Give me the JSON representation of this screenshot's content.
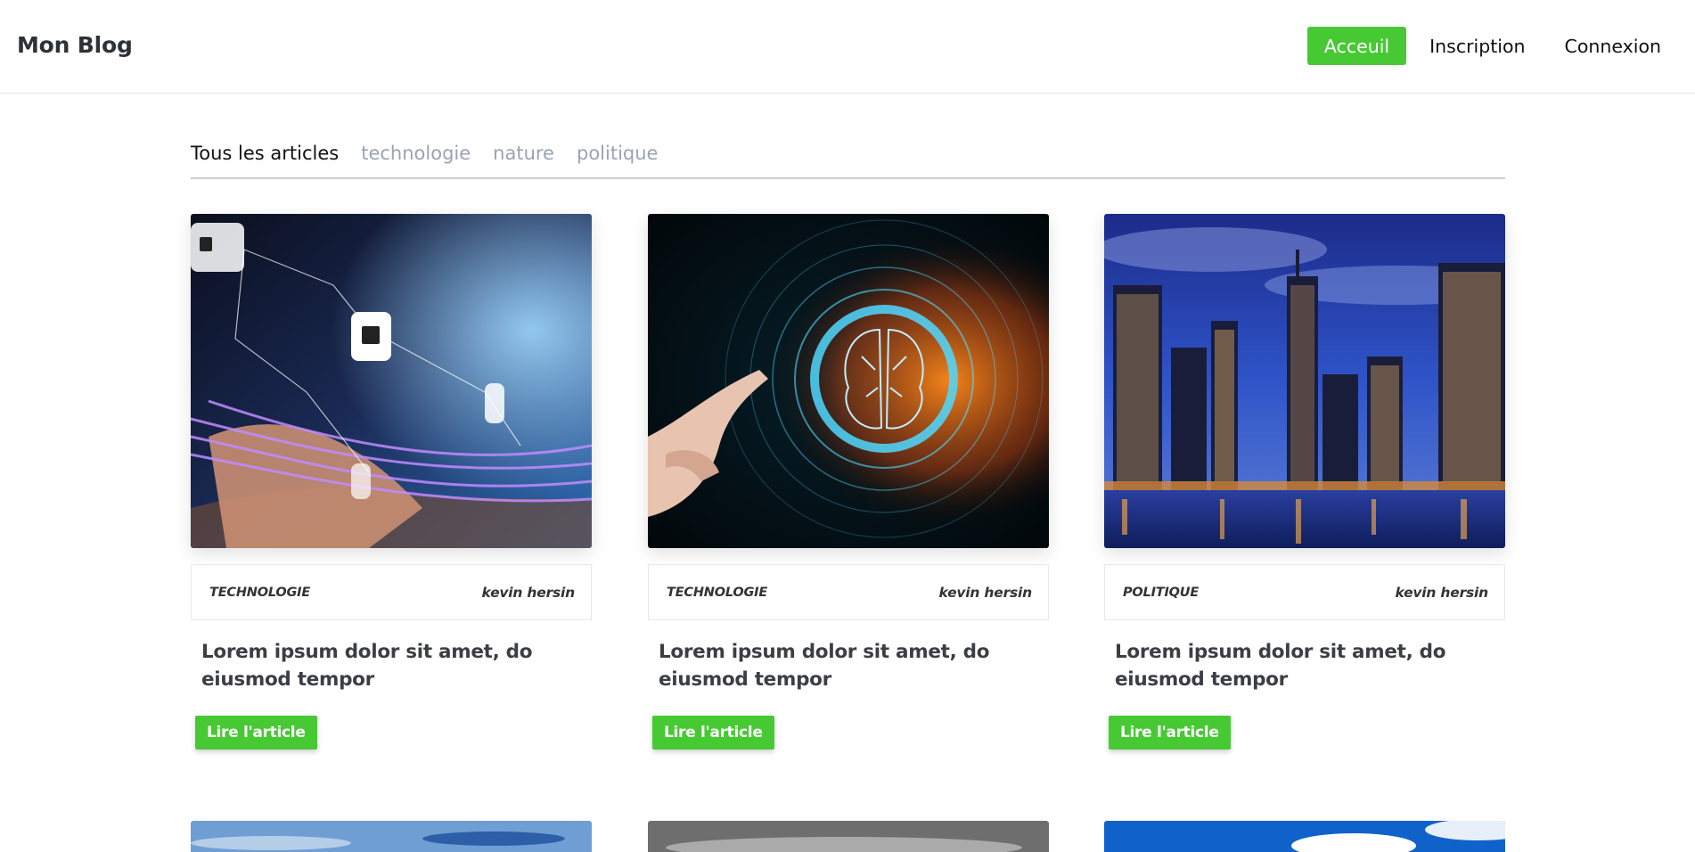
{
  "header": {
    "brand": "Mon Blog",
    "nav": [
      {
        "label": "Acceuil",
        "active": true
      },
      {
        "label": "Inscription",
        "active": false
      },
      {
        "label": "Connexion",
        "active": false
      }
    ]
  },
  "tabs": [
    {
      "label": "Tous les articles",
      "active": true
    },
    {
      "label": "technologie",
      "active": false
    },
    {
      "label": "nature",
      "active": false
    },
    {
      "label": "politique",
      "active": false
    }
  ],
  "articles": [
    {
      "image": "cybersecurity-padlocks-photo",
      "category": "TECHNOLOGIE",
      "author": "kevin hersin",
      "title": "Lorem ipsum dolor sit amet, do eiusmod tempor",
      "button": "Lire l'article"
    },
    {
      "image": "ai-brain-circuit-photo",
      "category": "TECHNOLOGIE",
      "author": "kevin hersin",
      "title": "Lorem ipsum dolor sit amet, do eiusmod tempor",
      "button": "Lire l'article"
    },
    {
      "image": "city-skyline-night-photo",
      "category": "POLITIQUE",
      "author": "kevin hersin",
      "title": "Lorem ipsum dolor sit amet, do eiusmod tempor",
      "button": "Lire l'article"
    }
  ],
  "more_articles": [
    {
      "image": "blue-sky-clouds-photo"
    },
    {
      "image": "grey-cloudy-sky-photo"
    },
    {
      "image": "bright-blue-sky-photo"
    }
  ],
  "colors": {
    "accent": "#47c933",
    "tab_inactive": "#9aa3b4",
    "text": "#2d3238"
  }
}
